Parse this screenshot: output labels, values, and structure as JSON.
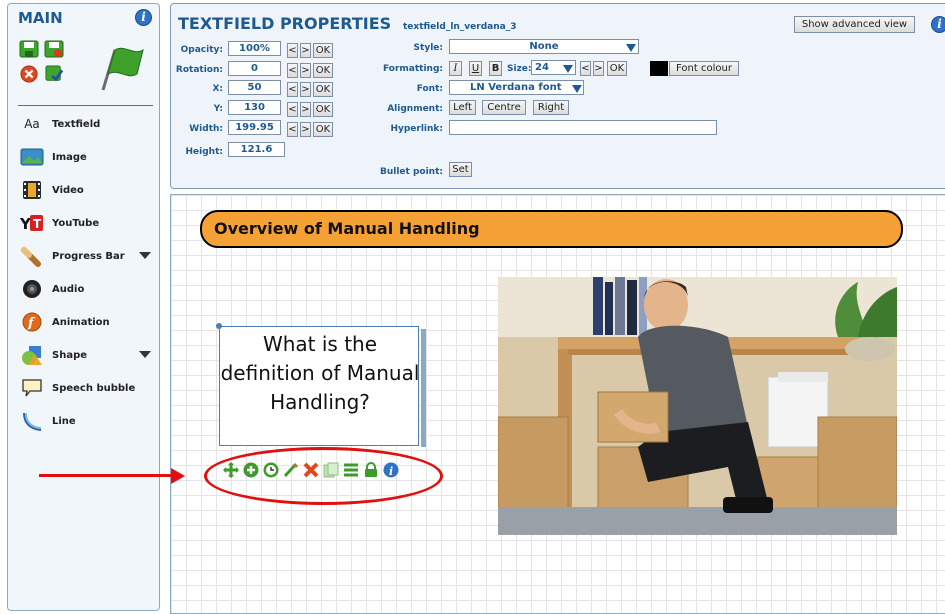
{
  "sidebar": {
    "title": "MAIN",
    "items": [
      {
        "label": "Textfield",
        "icon": "textfield-icon",
        "has_dropdown": false
      },
      {
        "label": "Image",
        "icon": "image-icon",
        "has_dropdown": false
      },
      {
        "label": "Video",
        "icon": "video-icon",
        "has_dropdown": false
      },
      {
        "label": "YouTube",
        "icon": "youtube-icon",
        "has_dropdown": false
      },
      {
        "label": "Progress Bar",
        "icon": "progress-bar-icon",
        "has_dropdown": true
      },
      {
        "label": "Audio",
        "icon": "audio-icon",
        "has_dropdown": false
      },
      {
        "label": "Animation",
        "icon": "animation-icon",
        "has_dropdown": false
      },
      {
        "label": "Shape",
        "icon": "shape-icon",
        "has_dropdown": true
      },
      {
        "label": "Speech bubble",
        "icon": "speech-bubble-icon",
        "has_dropdown": false
      },
      {
        "label": "Line",
        "icon": "line-icon",
        "has_dropdown": false
      }
    ],
    "textfield_glyph": "Aa"
  },
  "properties": {
    "title": "TEXTFIELD PROPERTIES",
    "object_id": "textfield_ln_verdana_3",
    "advanced_button": "Show advanced view",
    "opacity": {
      "label": "Opacity:",
      "value": "100%"
    },
    "rotation": {
      "label": "Rotation:",
      "value": "0"
    },
    "x": {
      "label": "X:",
      "value": "50"
    },
    "y": {
      "label": "Y:",
      "value": "130"
    },
    "width": {
      "label": "Width:",
      "value": "199.95"
    },
    "height": {
      "label": "Height:",
      "value": "121.6"
    },
    "dec_label": "<",
    "inc_label": ">",
    "ok_label": "OK",
    "style": {
      "label": "Style:",
      "value": "None"
    },
    "formatting": {
      "label": "Formatting:",
      "italic": "I",
      "underline": "U",
      "bold": "B",
      "size_label": "Size:",
      "size_value": "24",
      "font_colour_button": "Font colour",
      "font_colour": "#000000"
    },
    "font": {
      "label": "Font:",
      "value": "LN Verdana font"
    },
    "alignment": {
      "label": "Alignment:",
      "left": "Left",
      "centre": "Centre",
      "right": "Right"
    },
    "hyperlink": {
      "label": "Hyperlink:",
      "value": ""
    },
    "bullet_point": {
      "label": "Bullet point:",
      "button": "Set"
    }
  },
  "canvas": {
    "banner_title": "Overview of Manual Handling",
    "textbox_text": "What is the definition of Manual Handling?",
    "toolbar_icons": [
      "move-icon",
      "add-icon",
      "clock-icon",
      "edit-pen-icon",
      "delete-icon",
      "copy-icon",
      "layers-icon",
      "lock-icon",
      "info-icon"
    ]
  },
  "colors": {
    "accent_blue": "#1e5a90",
    "banner_orange": "#f5a135",
    "annotation_red": "#e20f0f"
  }
}
